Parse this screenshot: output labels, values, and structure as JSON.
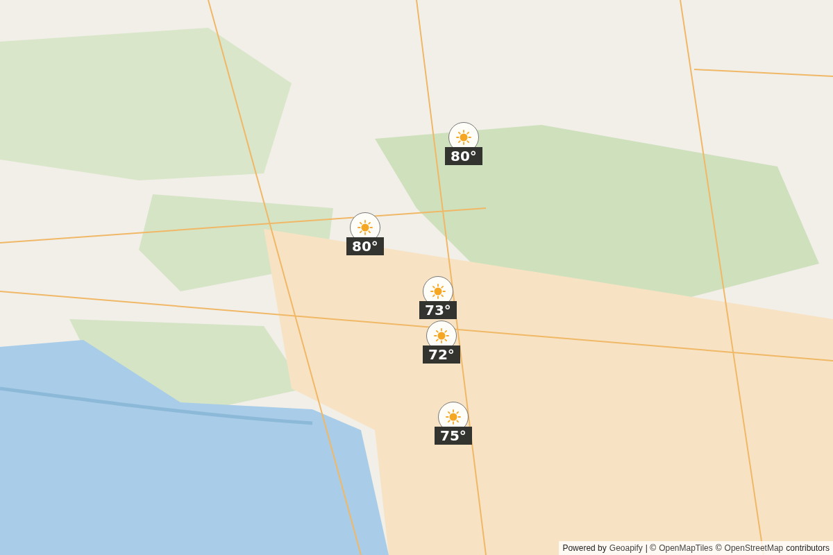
{
  "weather_markers": [
    {
      "temperature": "80°"
    },
    {
      "temperature": "80°"
    },
    {
      "temperature": "73°"
    },
    {
      "temperature": "72°"
    },
    {
      "temperature": "75°"
    }
  ],
  "attribution": {
    "prefix": "Powered by",
    "links": [
      "Geoapify",
      "OpenMapTiles",
      "OpenStreetMap"
    ],
    "separator": "|",
    "copyright": "©",
    "suffix": "contributors"
  }
}
